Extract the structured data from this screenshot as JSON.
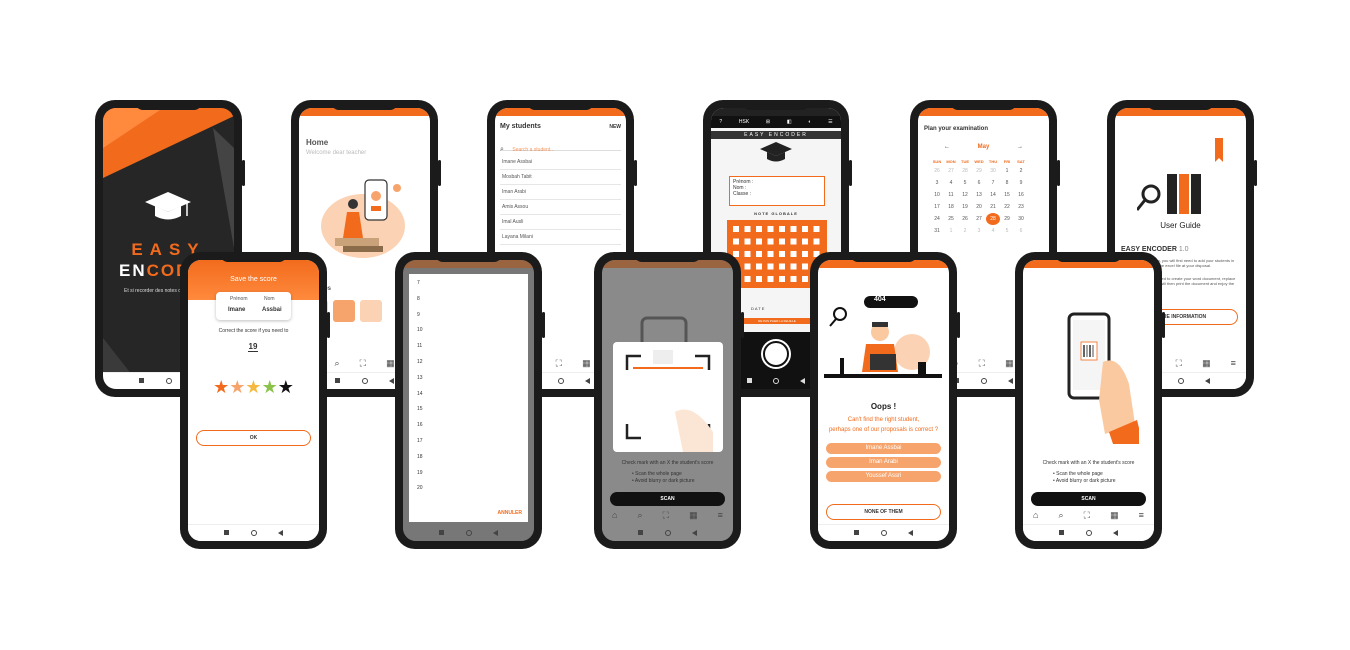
{
  "brand": {
    "accent": "#f26b1d",
    "dark": "#222222",
    "light_accent": "#f7a46c"
  },
  "splash": {
    "title_line1": "EASY",
    "title_line2_a": "EN",
    "title_line2_b": "CODER",
    "tagline": "Et si recorder des notes devenait simple"
  },
  "home": {
    "title": "Home",
    "subtitle": "Welcome dear teacher",
    "section": "Features"
  },
  "students": {
    "title": "My students",
    "new_label": "NEW",
    "search_placeholder": "Search a student...",
    "items": [
      "Imane Assbai",
      "Mosbah Tabit",
      "Iman Arabi",
      "Amis Assou",
      "Imal Ausli",
      "Layana Milani"
    ]
  },
  "encoder": {
    "toolbar": [
      "?",
      "HSK",
      "⊞",
      "◧",
      "◐",
      "☰"
    ],
    "brand": "EASY ENCODER",
    "field_prenom": "Prénom :",
    "field_nom": "Nom :",
    "field_classe": "Classe :",
    "grid_title": "NOTE GLOBALE",
    "date_label": "DATE",
    "footer": "NE PAS PLIER LA FEUILLE"
  },
  "calendar": {
    "title": "Plan your examination",
    "month": "May",
    "prev": "←",
    "next": "→",
    "days": [
      "SUN",
      "MON",
      "TUE",
      "WED",
      "THU",
      "FRI",
      "SAT"
    ],
    "weeks": [
      [
        "26",
        "27",
        "28",
        "29",
        "30",
        "1",
        "2"
      ],
      [
        "3",
        "4",
        "5",
        "6",
        "7",
        "8",
        "9"
      ],
      [
        "10",
        "11",
        "12",
        "13",
        "14",
        "15",
        "16"
      ],
      [
        "17",
        "18",
        "19",
        "20",
        "21",
        "22",
        "23"
      ],
      [
        "24",
        "25",
        "26",
        "27",
        "28",
        "29",
        "30"
      ],
      [
        "31",
        "1",
        "2",
        "3",
        "4",
        "5",
        "6"
      ]
    ],
    "selected": "28"
  },
  "guide": {
    "title": "User Guide",
    "app_name": "EASY ENCODER",
    "version": "1.0",
    "text1": "To use the application, you will first need to add your students in the application using the excel file at your disposal.",
    "text2": "Once done, you will need to create your word document, replace by 'publipostage', you will then print the document and enjoy the magic of the EASY",
    "button": "MORE INFORMATION"
  },
  "score": {
    "title": "Save the score",
    "prenom_label": "Prénom",
    "nom_label": "Nom",
    "prenom": "Imane",
    "nom": "Assbai",
    "instruction": "Correct the score if you need to",
    "value": "19",
    "stars": 5,
    "ok": "OK"
  },
  "picker": {
    "numbers": [
      "7",
      "8",
      "9",
      "10",
      "11",
      "12",
      "13",
      "14",
      "15",
      "16",
      "17",
      "18",
      "19",
      "20"
    ],
    "cancel": "ANNULER"
  },
  "scan_dim": {
    "hint": "Check mark with an X the student's score",
    "tips": [
      "• Scan the whole page",
      "• Avoid blurry or dark picture"
    ],
    "button": "SCAN"
  },
  "oops": {
    "code": "404",
    "title": "Oops !",
    "line1": "Can't find the right student,",
    "line2": "perhaps one of our proposals is correct ?",
    "options": [
      "Imane Assbai",
      "Iman Arabi",
      "Youssef Assri"
    ],
    "none": "NONE OF THEM"
  },
  "scan": {
    "hint": "Check mark with an X the student's score",
    "tips": [
      "• Scan the whole page",
      "• Avoid blurry or dark picture"
    ],
    "button": "SCAN"
  },
  "icons": {
    "home": "home-icon",
    "search": "search-icon",
    "scan": "scan-icon",
    "calendar": "calendar-icon",
    "menu": "menu-icon"
  }
}
